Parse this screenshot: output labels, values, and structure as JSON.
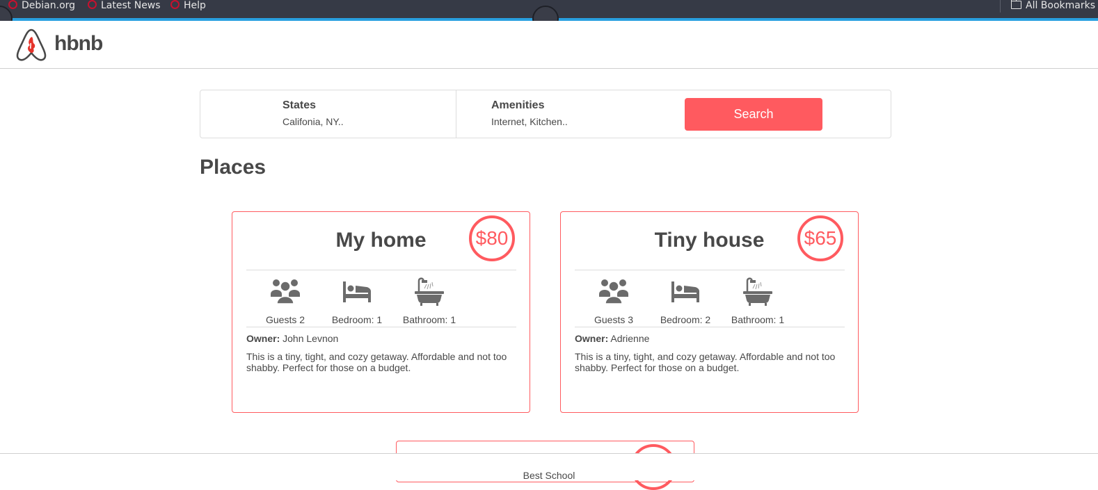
{
  "browser": {
    "bookmarks": [
      {
        "label": "Debian.org",
        "icon": "debian-swirl-icon"
      },
      {
        "label": "Latest News",
        "icon": "debian-swirl-icon"
      },
      {
        "label": "Help",
        "icon": "debian-swirl-icon"
      }
    ],
    "all_bookmarks_label": "All Bookmarks",
    "accent": "#29a0e0"
  },
  "header": {
    "logo_text": "hbnb",
    "logo_icon": "hbnb-logo-icon"
  },
  "filters": {
    "states_title": "States",
    "states_value": "Califonia, NY..",
    "amenities_title": "Amenities",
    "amenities_value": "Internet, Kitchen..",
    "search_label": "Search"
  },
  "places_title": "Places",
  "places": [
    {
      "name": "My home",
      "price": "$80",
      "guests": "Guests 2",
      "bedrooms": "Bedroom: 1",
      "bathrooms": "Bathroom: 1",
      "owner_label": "Owner:",
      "owner": "John Levnon",
      "description": "This is a tiny, tight, and cozy getaway. Affordable and not too shabby. Perfect for those on a budget."
    },
    {
      "name": "Tiny house",
      "price": "$65",
      "guests": "Guests 3",
      "bedrooms": "Bedroom: 2",
      "bathrooms": "Bathroom: 1",
      "owner_label": "Owner:",
      "owner": "Adrienne",
      "description": "This is a tiny, tight, and cozy getaway. Affordable and not too shabby. Perfect for those on a budget."
    }
  ],
  "footer": {
    "text": "Best School"
  },
  "colors": {
    "brand": "#ff5a5f",
    "text": "#484848",
    "border": "#dddddd"
  }
}
